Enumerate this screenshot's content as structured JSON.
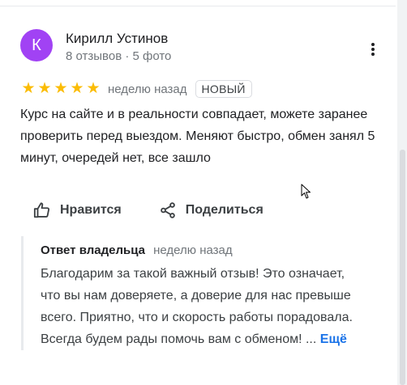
{
  "review": {
    "avatar_letter": "К",
    "avatar_color": "#a142f4",
    "author_name": "Кирилл Устинов",
    "author_meta": "8 отзывов · 5 фото",
    "rating": 5,
    "stars": [
      "★",
      "★",
      "★",
      "★",
      "★"
    ],
    "star_color": "#fbbc04",
    "date": "неделю назад",
    "badge": "НОВЫЙ",
    "text": "Курс на сайте и в реальности совпадает, можете заранее проверить перед выездом. Меняют быстро, обмен занял 5 минут, очередей нет, все зашло",
    "more_icon": "more-vert-icon"
  },
  "actions": {
    "like_label": "Нравится",
    "like_icon": "thumb-up-icon",
    "share_label": "Поделиться",
    "share_icon": "share-icon"
  },
  "owner_response": {
    "title": "Ответ владельца",
    "date": "неделю назад",
    "text": "Благодарим за такой важный отзыв! Это означает, что вы нам доверяете, а доверие для нас превыше всего. Приятно, что и скорость работы порадовала. Всегда будем рады помочь вам с обменом! ...",
    "more_label": "Ещё",
    "link_color": "#1a73e8"
  }
}
